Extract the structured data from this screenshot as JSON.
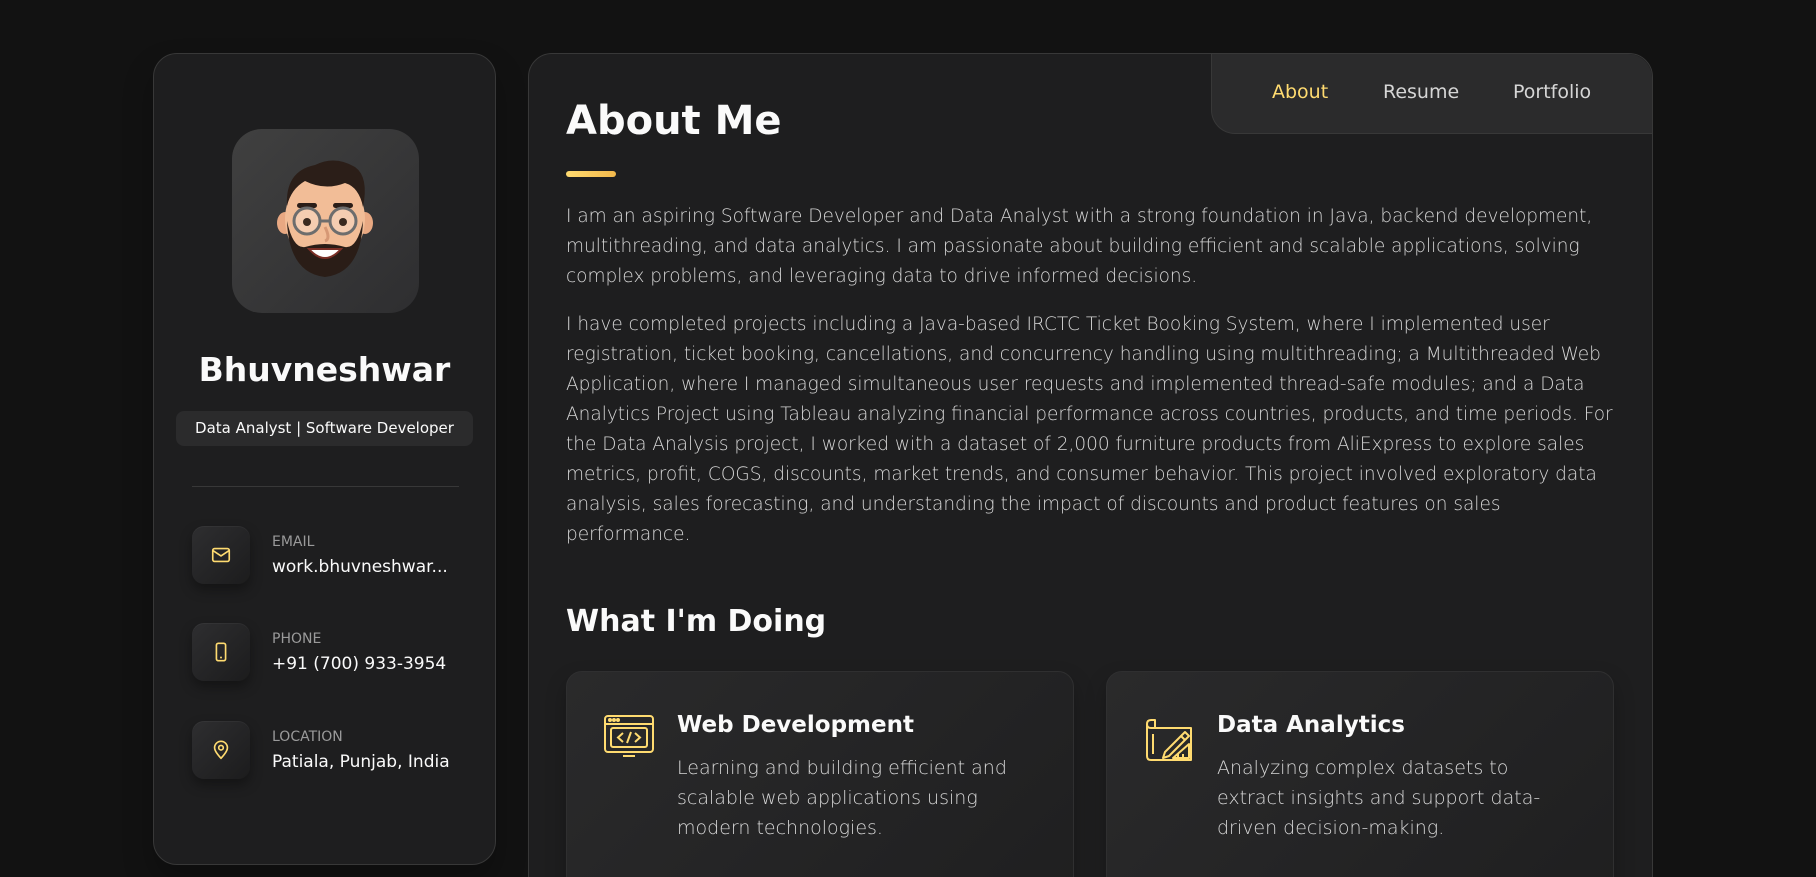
{
  "colors": {
    "accent": "#ffdb70",
    "background": "#121212",
    "panel": "#1e1e1f",
    "text": "#fafafa",
    "muted_text": "#d6d6d6"
  },
  "sidebar": {
    "avatar_icon": "memoji-avatar",
    "name": "Bhuvneshwar",
    "title": "Data Analyst | Software Developer",
    "contacts": [
      {
        "icon": "mail-icon",
        "label": "Email",
        "value": "work.bhuvneshwar..."
      },
      {
        "icon": "phone-icon",
        "label": "Phone",
        "value": "+91 (700) 933-3954"
      },
      {
        "icon": "location-pin-icon",
        "label": "Location",
        "value": "Patiala, Punjab, India"
      }
    ]
  },
  "navbar": {
    "items": [
      {
        "label": "About",
        "active": true
      },
      {
        "label": "Resume",
        "active": false
      },
      {
        "label": "Portfolio",
        "active": false
      }
    ]
  },
  "about": {
    "title": "About Me",
    "paragraphs": [
      "I am an aspiring Software Developer and Data Analyst with a strong foundation in Java, backend development, multithreading, and data analytics. I am passionate about building efficient and scalable applications, solving complex problems, and leveraging data to drive informed decisions.",
      "I have completed projects including a Java-based IRCTC Ticket Booking System, where I implemented user registration, ticket booking, cancellations, and concurrency handling using multithreading; a Multithreaded Web Application, where I managed simultaneous user requests and implemented thread-safe modules; and a Data Analytics Project using Tableau analyzing financial performance across countries, products, and time periods. For the Data Analysis project, I worked with a dataset of 2,000 furniture products from AliExpress to explore sales metrics, profit, COGS, discounts, market trends, and consumer behavior. This project involved exploratory data analysis, sales forecasting, and understanding the impact of discounts and product features on sales performance."
    ]
  },
  "services": {
    "title": "What I'm Doing",
    "items": [
      {
        "icon": "code-window-icon",
        "title": "Web Development",
        "text": "Learning and building efficient and scalable web applications using modern technologies."
      },
      {
        "icon": "blueprint-design-icon",
        "title": "Data Analytics",
        "text": "Analyzing complex datasets to extract insights and support data-driven decision-making."
      }
    ]
  }
}
